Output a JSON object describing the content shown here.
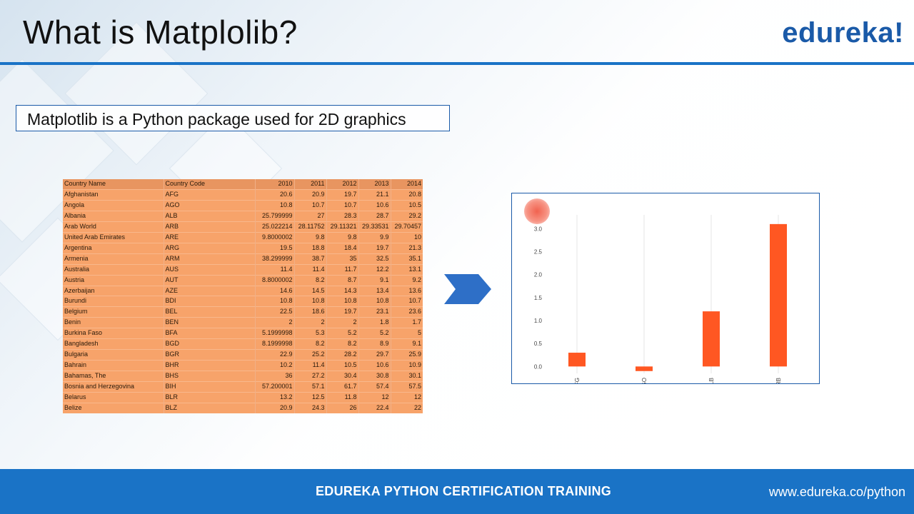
{
  "slide": {
    "title": "What is Matplolib?",
    "logo": "edureka!",
    "callout": "Matplotlib is a Python package used for 2D graphics"
  },
  "colors": {
    "accent": "#1a73c6",
    "table_fill": "#f7a36a",
    "bar": "#ff5722"
  },
  "icons": {
    "arrow": "right-chevron-arrow-icon"
  },
  "table": {
    "headers": [
      "Country Name",
      "Country Code",
      "2010",
      "2011",
      "2012",
      "2013",
      "2014"
    ],
    "rows": [
      [
        "Afghanistan",
        "AFG",
        "20.6",
        "20.9",
        "19.7",
        "21.1",
        "20.8"
      ],
      [
        "Angola",
        "AGO",
        "10.8",
        "10.7",
        "10.7",
        "10.6",
        "10.5"
      ],
      [
        "Albania",
        "ALB",
        "25.799999",
        "27",
        "28.3",
        "28.7",
        "29.2"
      ],
      [
        "Arab World",
        "ARB",
        "25.022214",
        "28.11752",
        "29.11321",
        "29.33531",
        "29.70457"
      ],
      [
        "United Arab Emirates",
        "ARE",
        "9.8000002",
        "9.8",
        "9.8",
        "9.9",
        "10"
      ],
      [
        "Argentina",
        "ARG",
        "19.5",
        "18.8",
        "18.4",
        "19.7",
        "21.3"
      ],
      [
        "Armenia",
        "ARM",
        "38.299999",
        "38.7",
        "35",
        "32.5",
        "35.1"
      ],
      [
        "Australia",
        "AUS",
        "11.4",
        "11.4",
        "11.7",
        "12.2",
        "13.1"
      ],
      [
        "Austria",
        "AUT",
        "8.8000002",
        "8.2",
        "8.7",
        "9.1",
        "9.2"
      ],
      [
        "Azerbaijan",
        "AZE",
        "14.6",
        "14.5",
        "14.3",
        "13.4",
        "13.6"
      ],
      [
        "Burundi",
        "BDI",
        "10.8",
        "10.8",
        "10.8",
        "10.8",
        "10.7"
      ],
      [
        "Belgium",
        "BEL",
        "22.5",
        "18.6",
        "19.7",
        "23.1",
        "23.6"
      ],
      [
        "Benin",
        "BEN",
        "2",
        "2",
        "2",
        "1.8",
        "1.7"
      ],
      [
        "Burkina Faso",
        "BFA",
        "5.1999998",
        "5.3",
        "5.2",
        "5.2",
        "5"
      ],
      [
        "Bangladesh",
        "BGD",
        "8.1999998",
        "8.2",
        "8.2",
        "8.9",
        "9.1"
      ],
      [
        "Bulgaria",
        "BGR",
        "22.9",
        "25.2",
        "28.2",
        "29.7",
        "25.9"
      ],
      [
        "Bahrain",
        "BHR",
        "10.2",
        "11.4",
        "10.5",
        "10.6",
        "10.9"
      ],
      [
        "Bahamas, The",
        "BHS",
        "36",
        "27.2",
        "30.4",
        "30.8",
        "30.1"
      ],
      [
        "Bosnia and Herzegovina",
        "BIH",
        "57.200001",
        "57.1",
        "61.7",
        "57.4",
        "57.5"
      ],
      [
        "Belarus",
        "BLR",
        "13.2",
        "12.5",
        "11.8",
        "12",
        "12"
      ],
      [
        "Belize",
        "BLZ",
        "20.9",
        "24.3",
        "26",
        "22.4",
        "22"
      ]
    ]
  },
  "chart_data": {
    "type": "bar",
    "categories": [
      "AFG",
      "AGO",
      "ALB",
      "ARB"
    ],
    "values": [
      0.3,
      -0.1,
      1.2,
      3.1
    ],
    "yticks": [
      "0.0",
      "0.5",
      "1.0",
      "1.5",
      "2.0",
      "2.5",
      "3.0"
    ],
    "ylim": [
      -0.15,
      3.3
    ],
    "grid": "vertical",
    "xlabel": "",
    "ylabel": ""
  },
  "footer": {
    "course": "EDUREKA PYTHON CERTIFICATION TRAINING",
    "url": "www.edureka.co/python"
  }
}
